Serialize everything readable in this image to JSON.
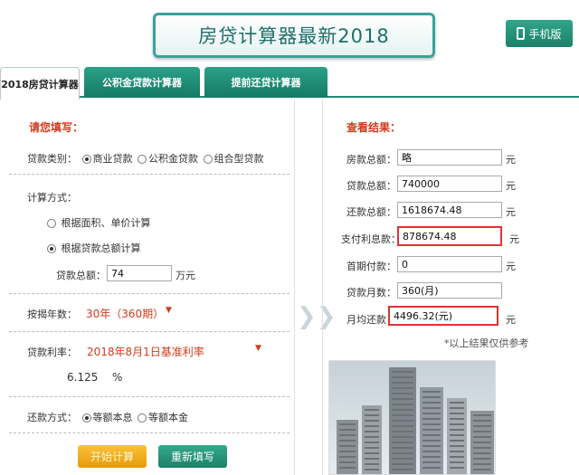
{
  "header": {
    "title": "房贷计算器最新2018",
    "mobile_btn": "手机版"
  },
  "tabs": [
    {
      "label": "2018房贷计算器",
      "active": true
    },
    {
      "label": "公积金贷款计算器",
      "active": false
    },
    {
      "label": "提前还贷计算器",
      "active": false
    }
  ],
  "form": {
    "heading": "请您填写：",
    "loan_type_label": "贷款类别：",
    "loan_types": [
      "商业贷款",
      "公积金贷款",
      "组合型贷款"
    ],
    "loan_type_selected": 0,
    "calc_method_label": "计算方式：",
    "calc_methods": [
      "根据面积、单价计算",
      "根据贷款总额计算"
    ],
    "calc_method_selected": 1,
    "loan_total_label": "贷款总额：",
    "loan_total_value": "74",
    "loan_total_unit": "万元",
    "years_label": "按揭年数：",
    "years_value": "30年（360期）",
    "rate_label": "贷款利率：",
    "rate_value": "2018年8月1日基准利率",
    "rate_number": "6.125",
    "rate_unit": "%",
    "repay_label": "还款方式：",
    "repay_methods": [
      "等额本息",
      "等额本金"
    ],
    "repay_selected": 0,
    "start_btn": "开始计算",
    "reset_btn": "重新填写"
  },
  "results": {
    "heading": "查看结果：",
    "unit": "元",
    "rows": [
      {
        "label": "房款总额：",
        "value": "略",
        "unit": "元"
      },
      {
        "label": "贷款总额：",
        "value": "740000",
        "unit": "元"
      },
      {
        "label": "还款总额：",
        "value": "1618674.48",
        "unit": "元"
      },
      {
        "label": "支付利息款：",
        "value": "878674.48",
        "unit": "元"
      },
      {
        "label": "首期付款：",
        "value": "0",
        "unit": "元"
      },
      {
        "label": "贷款月数：",
        "value": "360(月)",
        "unit": ""
      },
      {
        "label": "月均还款：",
        "value": "4496.32(元)",
        "unit": "元"
      }
    ],
    "note": "*以上结果仅供参考"
  },
  "colors": {
    "accent": "#1c8a74",
    "highlight": "#d33333",
    "label_red": "#d23a1e"
  }
}
